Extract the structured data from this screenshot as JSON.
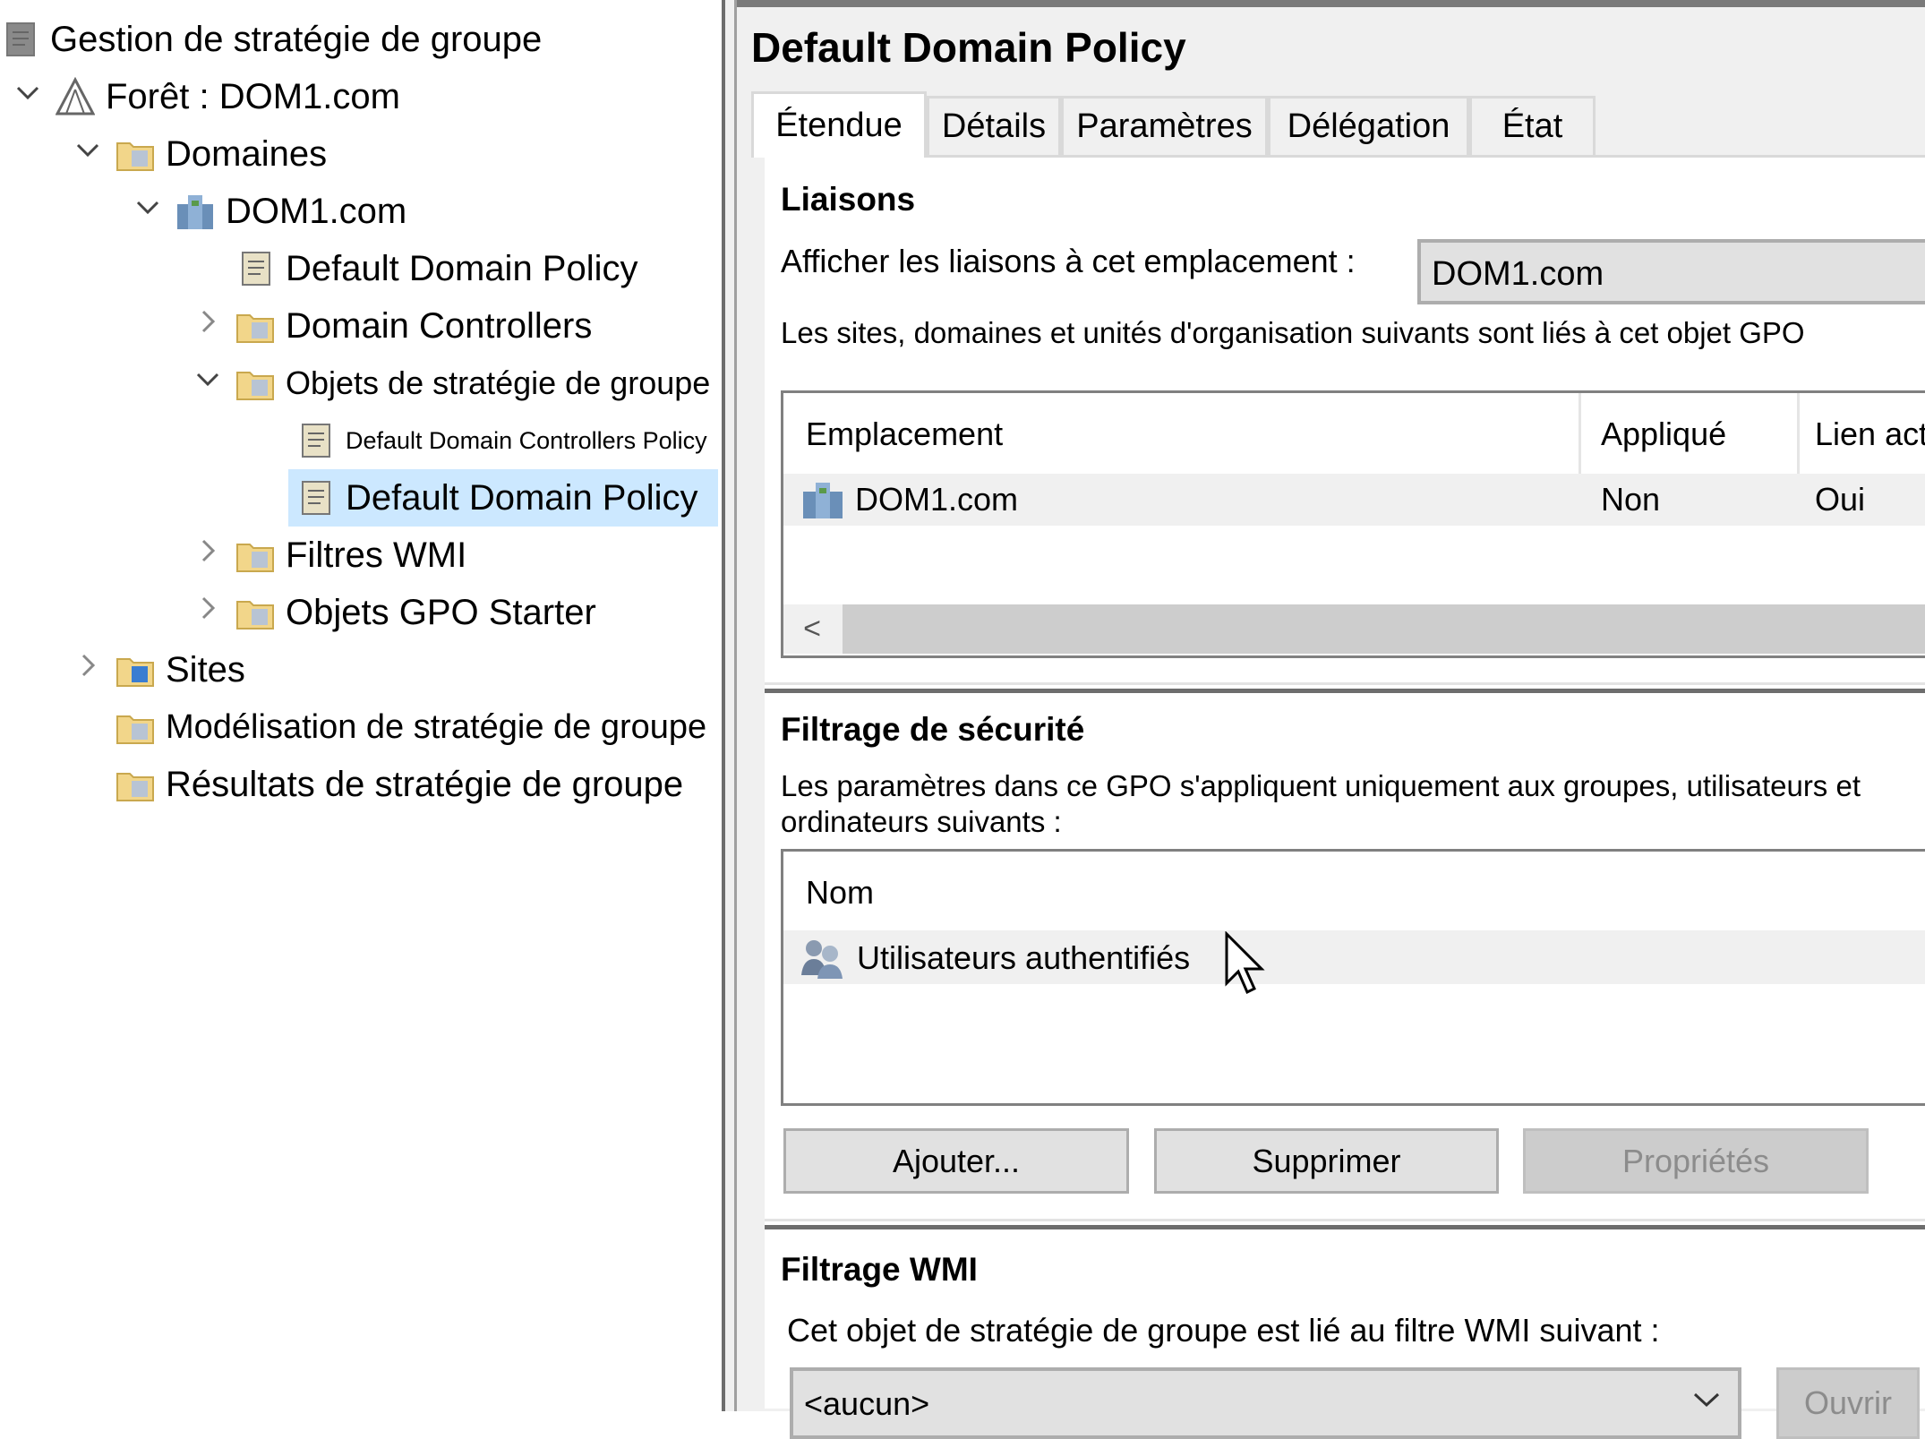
{
  "tree": {
    "items": [
      {
        "label": "Gestion de stratégie de groupe",
        "icon": "gpmc-root-icon",
        "level": 0,
        "chevron": ""
      },
      {
        "label": "Forêt : DOM1.com",
        "icon": "forest-icon",
        "level": 1,
        "chevron": "expanded"
      },
      {
        "label": "Domaines",
        "icon": "domains-folder-icon",
        "level": 2,
        "chevron": "expanded"
      },
      {
        "label": "DOM1.com",
        "icon": "domain-icon",
        "level": 3,
        "chevron": "expanded"
      },
      {
        "label": "Default Domain Policy",
        "icon": "gpo-link-icon",
        "level": 4,
        "chevron": ""
      },
      {
        "label": "Domain Controllers",
        "icon": "ou-folder-icon",
        "level": 4,
        "chevron": "collapsed"
      },
      {
        "label": "Objets de stratégie de groupe",
        "icon": "gpo-folder-icon",
        "level": 4,
        "chevron": "expanded"
      },
      {
        "label": "Default Domain Controllers Policy",
        "icon": "gpo-icon",
        "level": 5,
        "chevron": ""
      },
      {
        "label": "Default Domain Policy",
        "icon": "gpo-icon",
        "level": 5,
        "chevron": "",
        "selected": true
      },
      {
        "label": "Filtres WMI",
        "icon": "wmi-folder-icon",
        "level": 4,
        "chevron": "collapsed"
      },
      {
        "label": "Objets GPO Starter",
        "icon": "starter-gpo-folder-icon",
        "level": 4,
        "chevron": "collapsed"
      },
      {
        "label": "Sites",
        "icon": "sites-folder-icon",
        "level": 2,
        "chevron": "collapsed"
      },
      {
        "label": "Modélisation de stratégie de groupe",
        "icon": "modeling-icon",
        "level": 2,
        "chevron": ""
      },
      {
        "label": "Résultats de stratégie de groupe",
        "icon": "results-icon",
        "level": 2,
        "chevron": ""
      }
    ]
  },
  "details": {
    "title": "Default Domain Policy",
    "tabs": [
      "Étendue",
      "Détails",
      "Paramètres",
      "Délégation",
      "État"
    ],
    "active_tab": "Étendue",
    "links": {
      "heading": "Liaisons",
      "location_label": "Afficher les liaisons à cet emplacement :",
      "location_value": "DOM1.com",
      "description": "Les sites, domaines et unités d'organisation suivants sont liés à cet objet GPO",
      "columns": [
        "Emplacement",
        "Appliqué",
        "Lien activé"
      ],
      "rows": [
        {
          "location": "DOM1.com",
          "enforced": "Non",
          "enabled": "Oui"
        }
      ],
      "scroll_left": "<"
    },
    "security": {
      "heading": "Filtrage de sécurité",
      "description": "Les paramètres dans ce GPO s'appliquent uniquement aux groupes, utilisateurs et ordinateurs suivants :",
      "column": "Nom",
      "rows": [
        "Utilisateurs authentifiés"
      ],
      "buttons": {
        "add": "Ajouter...",
        "remove": "Supprimer",
        "properties": "Propriétés"
      }
    },
    "wmi": {
      "heading": "Filtrage WMI",
      "description": "Cet objet de stratégie de groupe est lié au filtre WMI suivant :",
      "selected": "<aucun>",
      "open_button": "Ouvrir"
    }
  },
  "colors": {
    "selection": "#cce8ff",
    "panel": "#f0f0f0",
    "row_highlight": "#f0f0f0"
  }
}
